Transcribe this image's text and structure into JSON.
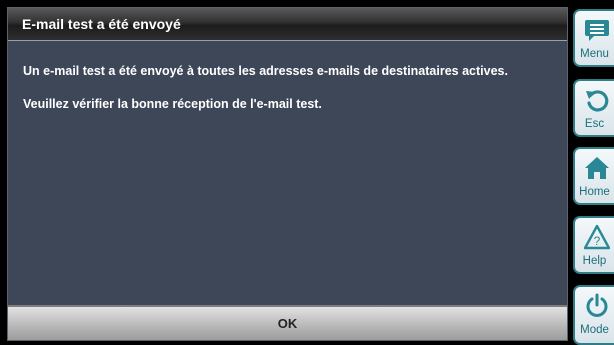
{
  "dialog": {
    "title": "E-mail test a été envoyé",
    "message_line1": "Un e-mail test a été envoyé à toutes les adresses e-mails de destinataires actives.",
    "message_line2": "Veuillez vérifier la bonne réception de l'e-mail test.",
    "ok_label": "OK"
  },
  "sidebar": {
    "items": [
      {
        "label": "Menu",
        "icon": "menu-icon"
      },
      {
        "label": "Esc",
        "icon": "back-arrow-icon"
      },
      {
        "label": "Home",
        "icon": "home-icon"
      },
      {
        "label": "Help",
        "icon": "help-icon"
      },
      {
        "label": "Mode",
        "icon": "power-icon"
      }
    ]
  },
  "colors": {
    "panel_bg": "#3d4757",
    "accent_teal": "#1c6f7a",
    "text_white": "#ffffff"
  }
}
